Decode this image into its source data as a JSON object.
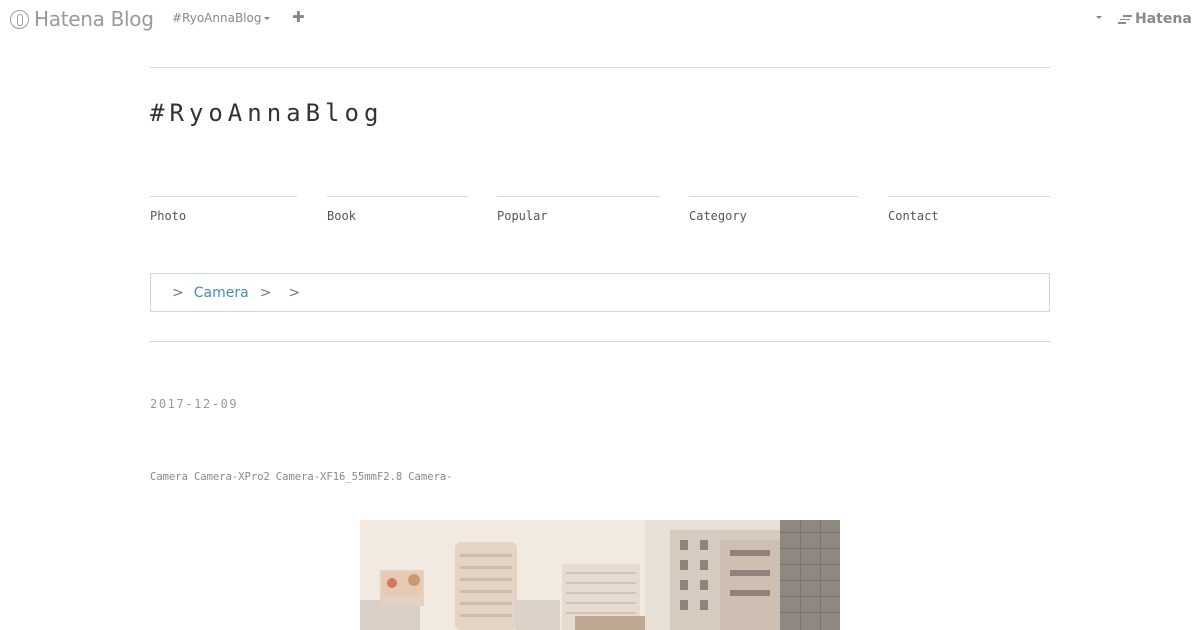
{
  "topbar": {
    "logo_text": "Hatena Blog",
    "blog_selector": "#RyoAnnaBlog",
    "add_symbol": "✚",
    "right_logo": "Hatena"
  },
  "blog": {
    "title": "#RyoAnnaBlog"
  },
  "nav": {
    "items": [
      {
        "label": "Photo"
      },
      {
        "label": "Book"
      },
      {
        "label": "Popular"
      },
      {
        "label": "Category"
      },
      {
        "label": "Contact"
      }
    ]
  },
  "breadcrumb": {
    "separator": ">",
    "link": "Camera"
  },
  "entry": {
    "date": "2017-12-09",
    "categories": [
      "Camera",
      "Camera-XPro2",
      "Camera-XF16_55mmF2.8",
      "Camera-"
    ]
  },
  "colors": {
    "link": "#3e8fb8",
    "rule": "#d8d8d8",
    "muted": "#999999"
  }
}
